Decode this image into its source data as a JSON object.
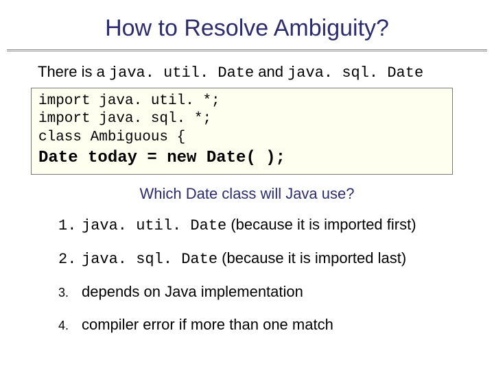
{
  "title": "How to Resolve Ambiguity?",
  "intro": {
    "prefix": "There is a ",
    "code1": "java. util. Date",
    "mid": " and ",
    "code2": "java. sql. Date"
  },
  "code": {
    "line1": "import java. util. *;",
    "line2": "import java. sql. *;",
    "line3": "class Ambiguous {",
    "emph": "Date today = new Date( );"
  },
  "question": "Which Date class will Java use?",
  "options": {
    "o1": {
      "num": "1.",
      "code": "java. util. Date",
      "rest": " (because it is imported first)"
    },
    "o2": {
      "num": "2.",
      "code": "java. sql. Date",
      "rest": " (because it is imported last)"
    },
    "o3": {
      "num": "3.",
      "text": "depends on Java implementation"
    },
    "o4": {
      "num": "4.",
      "text": "compiler error if more than one match"
    }
  }
}
